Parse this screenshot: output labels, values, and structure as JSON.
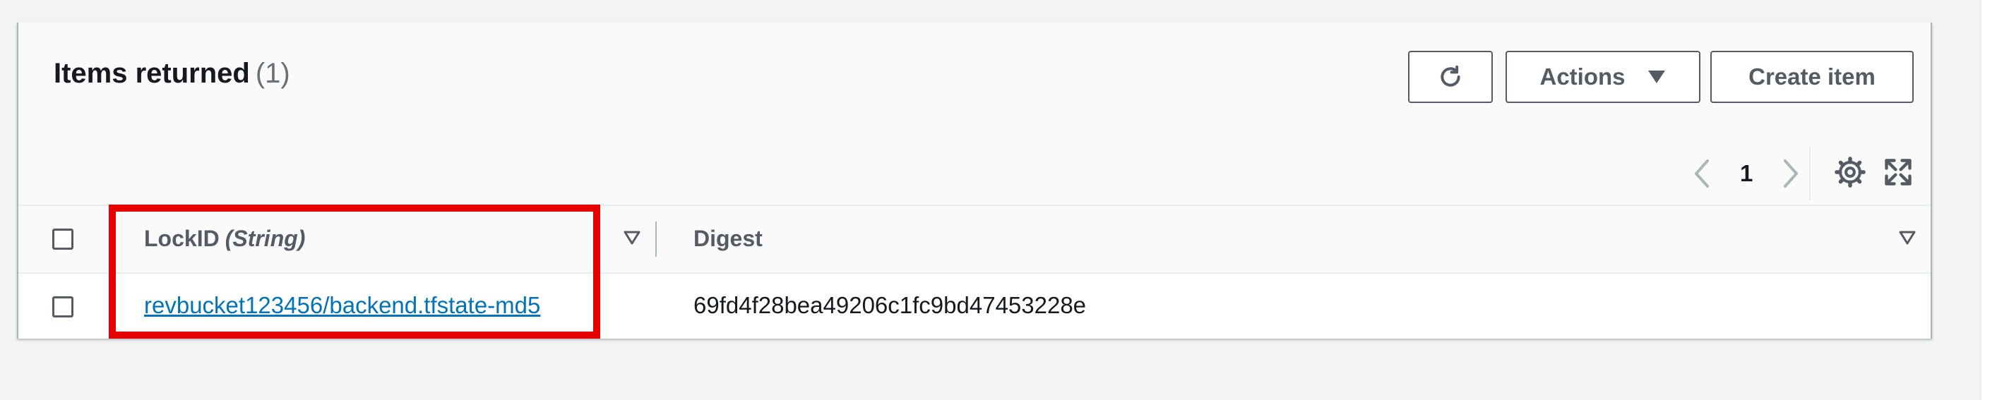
{
  "header": {
    "title": "Items returned",
    "count": "(1)"
  },
  "toolbar": {
    "refresh_icon": "refresh-icon",
    "actions_label": "Actions",
    "create_label": "Create item"
  },
  "pagination": {
    "current_page": "1"
  },
  "table": {
    "columns": [
      {
        "name": "LockID",
        "type": "(String)"
      },
      {
        "name": "Digest"
      }
    ],
    "rows": [
      {
        "lockid": "revbucket123456/backend.tfstate-md5",
        "digest": "69fd4f28bea49206c1fc9bd47453228e"
      }
    ]
  },
  "colors": {
    "link": "#0073bb",
    "highlight": "#e60000",
    "button_border": "#545b64"
  }
}
